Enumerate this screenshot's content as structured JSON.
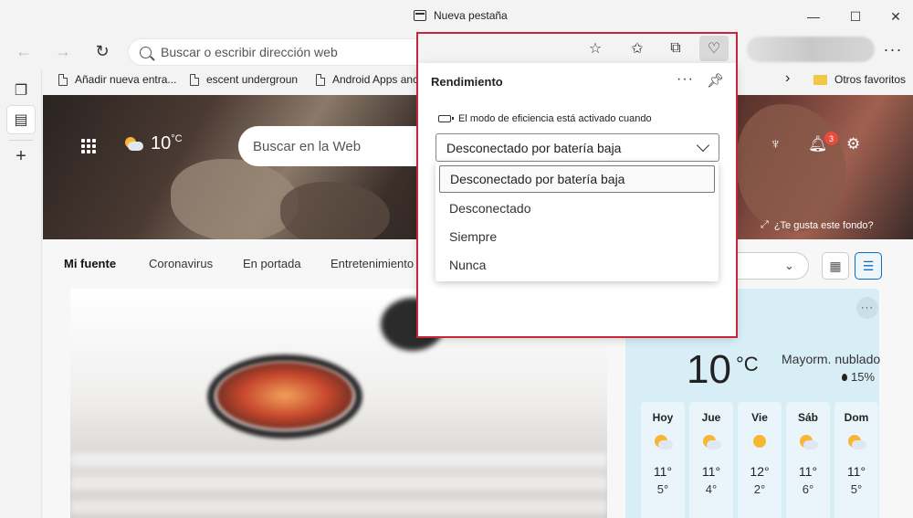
{
  "window": {
    "title": "Nueva pestaña"
  },
  "toolbar": {
    "address_placeholder": "Buscar o escribir dirección web",
    "more": "···"
  },
  "favorites": {
    "items": [
      {
        "label": "Añadir nueva entra..."
      },
      {
        "label": "escent undergroun"
      },
      {
        "label": "Android Apps anc"
      }
    ],
    "chevron": "›",
    "other": "Otros favoritos"
  },
  "hero": {
    "temp": "10",
    "unit": "°C",
    "search_placeholder": "Buscar en la Web",
    "notifications": "3",
    "bg_prompt": "¿Te gusta este fondo?"
  },
  "feed": {
    "tabs": [
      {
        "label": "Mi fuente",
        "active": true
      },
      {
        "label": "Coronavirus"
      },
      {
        "label": "En portada"
      },
      {
        "label": "Entretenimiento"
      }
    ]
  },
  "weather": {
    "temp": "10",
    "unit": "°C",
    "description": "Mayorm. nublado",
    "precip": "15%",
    "days": [
      {
        "name": "Hoy",
        "high": "11°",
        "low": "5°",
        "icon": "partly-cloudy"
      },
      {
        "name": "Jue",
        "high": "11°",
        "low": "4°",
        "icon": "partly-cloudy"
      },
      {
        "name": "Vie",
        "high": "12°",
        "low": "2°",
        "icon": "sunny"
      },
      {
        "name": "Sáb",
        "high": "11°",
        "low": "6°",
        "icon": "partly-cloudy"
      },
      {
        "name": "Dom",
        "high": "11°",
        "low": "5°",
        "icon": "partly-cloudy"
      }
    ]
  },
  "performance": {
    "title": "Rendimiento",
    "efficiency_label": "El modo de eficiencia está activado cuando",
    "selected": "Desconectado por batería baja",
    "options": [
      "Desconectado por batería baja",
      "Desconectado",
      "Siempre",
      "Nunca"
    ]
  },
  "colors": {
    "highlight": "#c7253a",
    "accent": "#0f6cbd",
    "notif": "#e74c3c"
  }
}
